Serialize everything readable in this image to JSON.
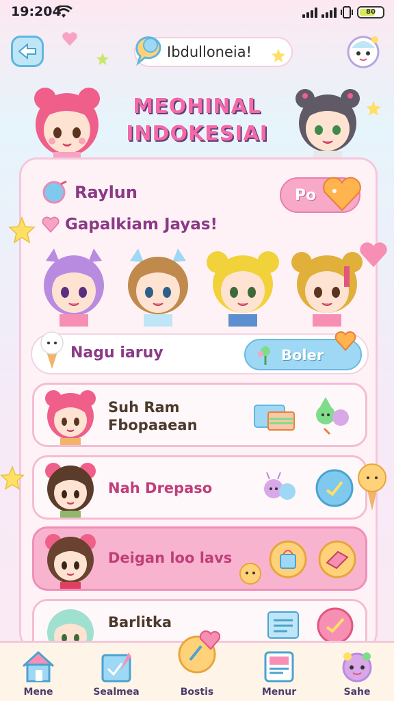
{
  "status_bar": {
    "time": "19:204",
    "battery": "80"
  },
  "search": {
    "value": "Ibdulloneia!"
  },
  "header": {
    "title_line1": "MEOHINAL",
    "title_line2": "INDOKESIAI"
  },
  "profile": {
    "username": "Raylun",
    "button_label": "Po"
  },
  "greeting": "Gapalkiam Jayas!",
  "section": {
    "title": "Nagu iaruy",
    "button_label": "Boler"
  },
  "list_items": [
    {
      "title": "Suh Ram Fbopaaean"
    },
    {
      "title": "Nah Drepaso"
    },
    {
      "title": "Deigan loo lavs"
    },
    {
      "title": "Barlitka"
    }
  ],
  "nav": [
    {
      "label": "Mene",
      "icon": "house-icon"
    },
    {
      "label": "Sealmea",
      "icon": "calendar-heart-icon"
    },
    {
      "label": "Bostis",
      "icon": "heart-bubble-icon"
    },
    {
      "label": "Menur",
      "icon": "tablet-icon"
    },
    {
      "label": "Sahe",
      "icon": "mascot-icon"
    }
  ],
  "colors": {
    "accent_pink": "#f36aa9",
    "accent_blue": "#9fd8f4",
    "text_purple": "#8a3a86",
    "card_bg": "#fff2f7"
  }
}
